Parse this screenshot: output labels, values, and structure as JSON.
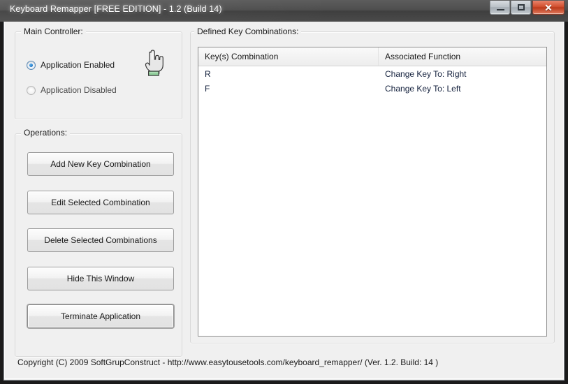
{
  "window": {
    "title": "Keyboard Remapper [FREE EDITION] - 1.2 (Build 14)",
    "controls": {
      "minimize": "minimize-button",
      "maximize": "maximize-button",
      "close": "close-button",
      "close_glyph": "✕"
    }
  },
  "main_controller": {
    "group_label": "Main Controller:",
    "options": [
      {
        "label": "Application Enabled",
        "selected": true
      },
      {
        "label": "Application Disabled",
        "selected": false
      }
    ],
    "icon": "hand-pointer-icon"
  },
  "operations": {
    "group_label": "Operations:",
    "buttons": [
      {
        "label": "Add New Key Combination",
        "focused": false
      },
      {
        "label": "Edit Selected Combination",
        "focused": false
      },
      {
        "label": "Delete Selected Combinations",
        "focused": false
      },
      {
        "label": "Hide This Window",
        "focused": false
      },
      {
        "label": "Terminate Application",
        "focused": true
      }
    ]
  },
  "combinations": {
    "group_label": "Defined Key Combinations:",
    "columns": [
      "Key(s) Combination",
      "Associated Function"
    ],
    "rows": [
      {
        "key": "R",
        "function": "Change Key To:  Right"
      },
      {
        "key": "F",
        "function": "Change Key To:  Left"
      }
    ]
  },
  "status": {
    "copyright": "Copyright (C) 2009 SoftGrupConstruct - http://www.easytousetools.com/keyboard_remapper/  (Ver. 1.2. Build: 14 )"
  },
  "colors": {
    "accent_blue": "#1f78c8",
    "close_red": "#d2502f",
    "row_text": "#14213d",
    "client_bg": "#f0f0f0"
  }
}
